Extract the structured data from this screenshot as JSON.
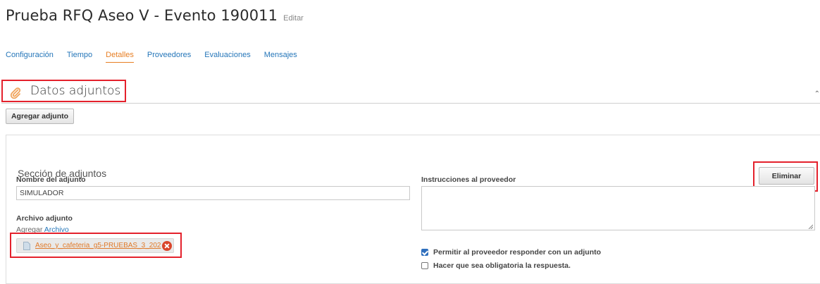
{
  "header": {
    "title": "Prueba RFQ Aseo V - Evento 190011",
    "edit_label": "Editar"
  },
  "tabs": [
    {
      "label": "Configuración",
      "active": false
    },
    {
      "label": "Tiempo",
      "active": false
    },
    {
      "label": "Detalles",
      "active": true
    },
    {
      "label": "Proveedores",
      "active": false
    },
    {
      "label": "Evaluaciones",
      "active": false
    },
    {
      "label": "Mensajes",
      "active": false
    }
  ],
  "section": {
    "title": "Datos adjuntos",
    "icon": "paperclip-icon",
    "add_button": "Agregar adjunto"
  },
  "attachment_panel": {
    "title": "Sección de adjuntos",
    "delete_button": "Eliminar",
    "name_label": "Nombre del adjunto",
    "name_value": "SIMULADOR",
    "file_label": "Archivo adjunto",
    "add_file_prefix": "Agregar",
    "add_file_link": "Archivo",
    "file_name": "Aseo_y_cafeteria_g5-PRUEBAS_3_202",
    "instructions_label": "Instrucciones al proveedor",
    "instructions_value": "",
    "options": [
      {
        "label": "Permitir al proveedor responder con un adjunto",
        "checked": true
      },
      {
        "label": "Hacer que sea obligatoria la respuesta.",
        "checked": false
      }
    ]
  },
  "colors": {
    "link": "#2576b9",
    "active_tab": "#e77e23",
    "highlight": "#e4212c",
    "checkbox": "#2f6fbd",
    "remove": "#d9452b"
  }
}
